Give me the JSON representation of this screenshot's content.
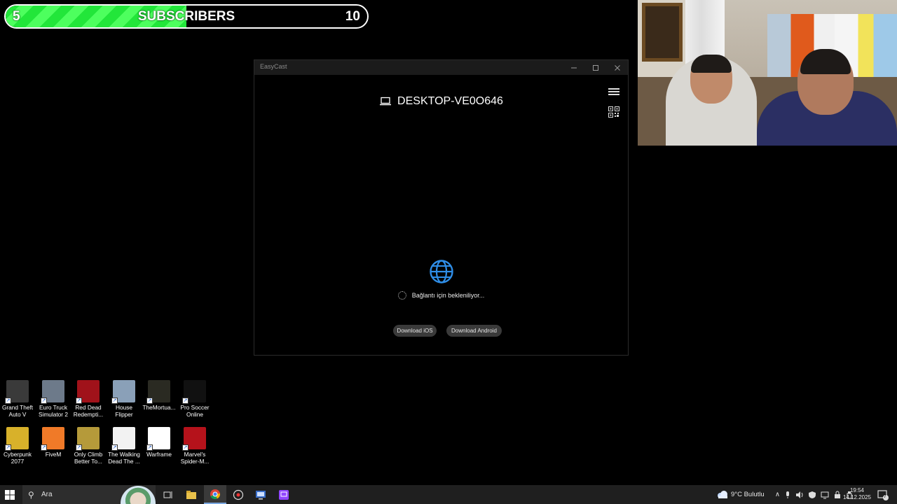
{
  "overlay": {
    "subscribers": {
      "current": "5",
      "label": "SUBSCRIBERS",
      "goal": "10",
      "progress_fraction": 0.5
    }
  },
  "window": {
    "title": "EasyCast",
    "device_name": "DESKTOP-VE0O646",
    "status_text": "Bağlantı için bekleniliyor...",
    "download_ios_label": "Download iOS",
    "download_android_label": "Download Android"
  },
  "desktop": {
    "icons_row1": [
      {
        "label": "Grand Theft Auto V",
        "icon": "gta-icon",
        "color": "#3a3a3a"
      },
      {
        "label": "Euro Truck Simulator 2",
        "icon": "truck-icon",
        "color": "#6d7a8a"
      },
      {
        "label": "Red Dead Redempti...",
        "icon": "rdr-icon",
        "color": "#a0121a"
      },
      {
        "label": "House Flipper",
        "icon": "house-icon",
        "color": "#8aa0b8"
      },
      {
        "label": "TheMortua...",
        "icon": "mortuary-icon",
        "color": "#2a2a22"
      },
      {
        "label": "Pro Soccer Online",
        "icon": "soccer-icon",
        "color": "#111111"
      }
    ],
    "icons_row2": [
      {
        "label": "Cyberpunk 2077",
        "icon": "cyberpunk-icon",
        "color": "#d8b12a"
      },
      {
        "label": "FiveM",
        "icon": "fivem-icon",
        "color": "#f07a28"
      },
      {
        "label": "Only Climb Better To...",
        "icon": "climb-icon",
        "color": "#b59a3a"
      },
      {
        "label": "The Walking Dead The ...",
        "icon": "walking-dead-icon",
        "color": "#f2f2f2"
      },
      {
        "label": "Warframe",
        "icon": "warframe-icon",
        "color": "#ffffff"
      },
      {
        "label": "Marvel's Spider-M...",
        "icon": "spiderman-icon",
        "color": "#b5121b"
      }
    ]
  },
  "taskbar": {
    "search_placeholder": "Ara",
    "weather": "9°C  Bulutlu",
    "time": "19:54",
    "date": "14.12.2025",
    "notification_count": "7"
  }
}
